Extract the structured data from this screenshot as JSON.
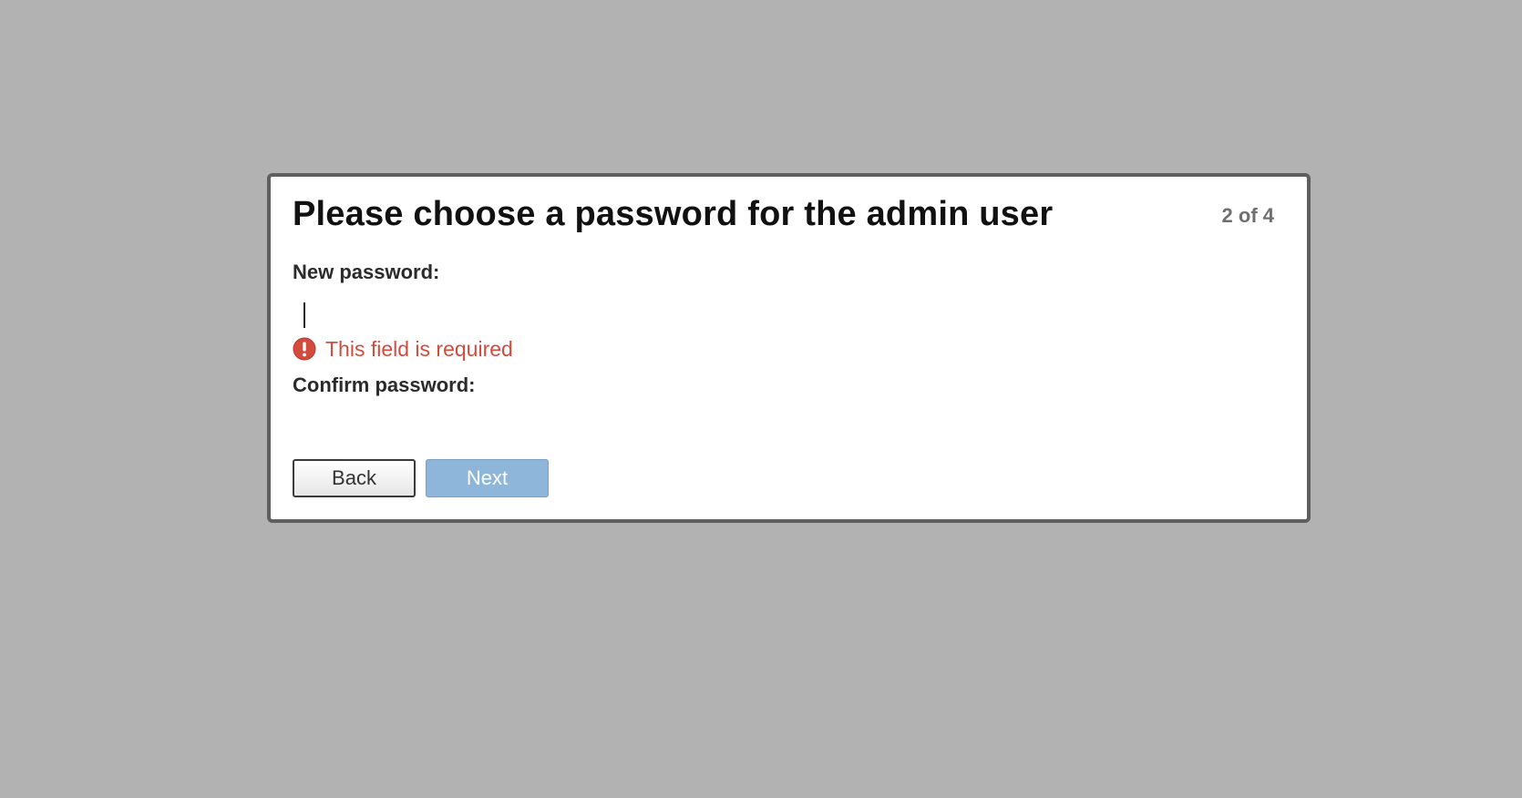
{
  "dialog": {
    "title": "Please choose a password for the admin user",
    "step": "2 of 4"
  },
  "form": {
    "new_password_label": "New password:",
    "new_password_value": "",
    "error_message": "This field is required",
    "confirm_password_label": "Confirm password:",
    "confirm_password_value": ""
  },
  "buttons": {
    "back": "Back",
    "next": "Next"
  },
  "icons": {
    "error": "exclamation-circle-icon"
  },
  "colors": {
    "backdrop": "#b2b2b2",
    "error": "#d24b3c",
    "next_button": "#8db6da",
    "step_text": "#6f6f6f"
  }
}
